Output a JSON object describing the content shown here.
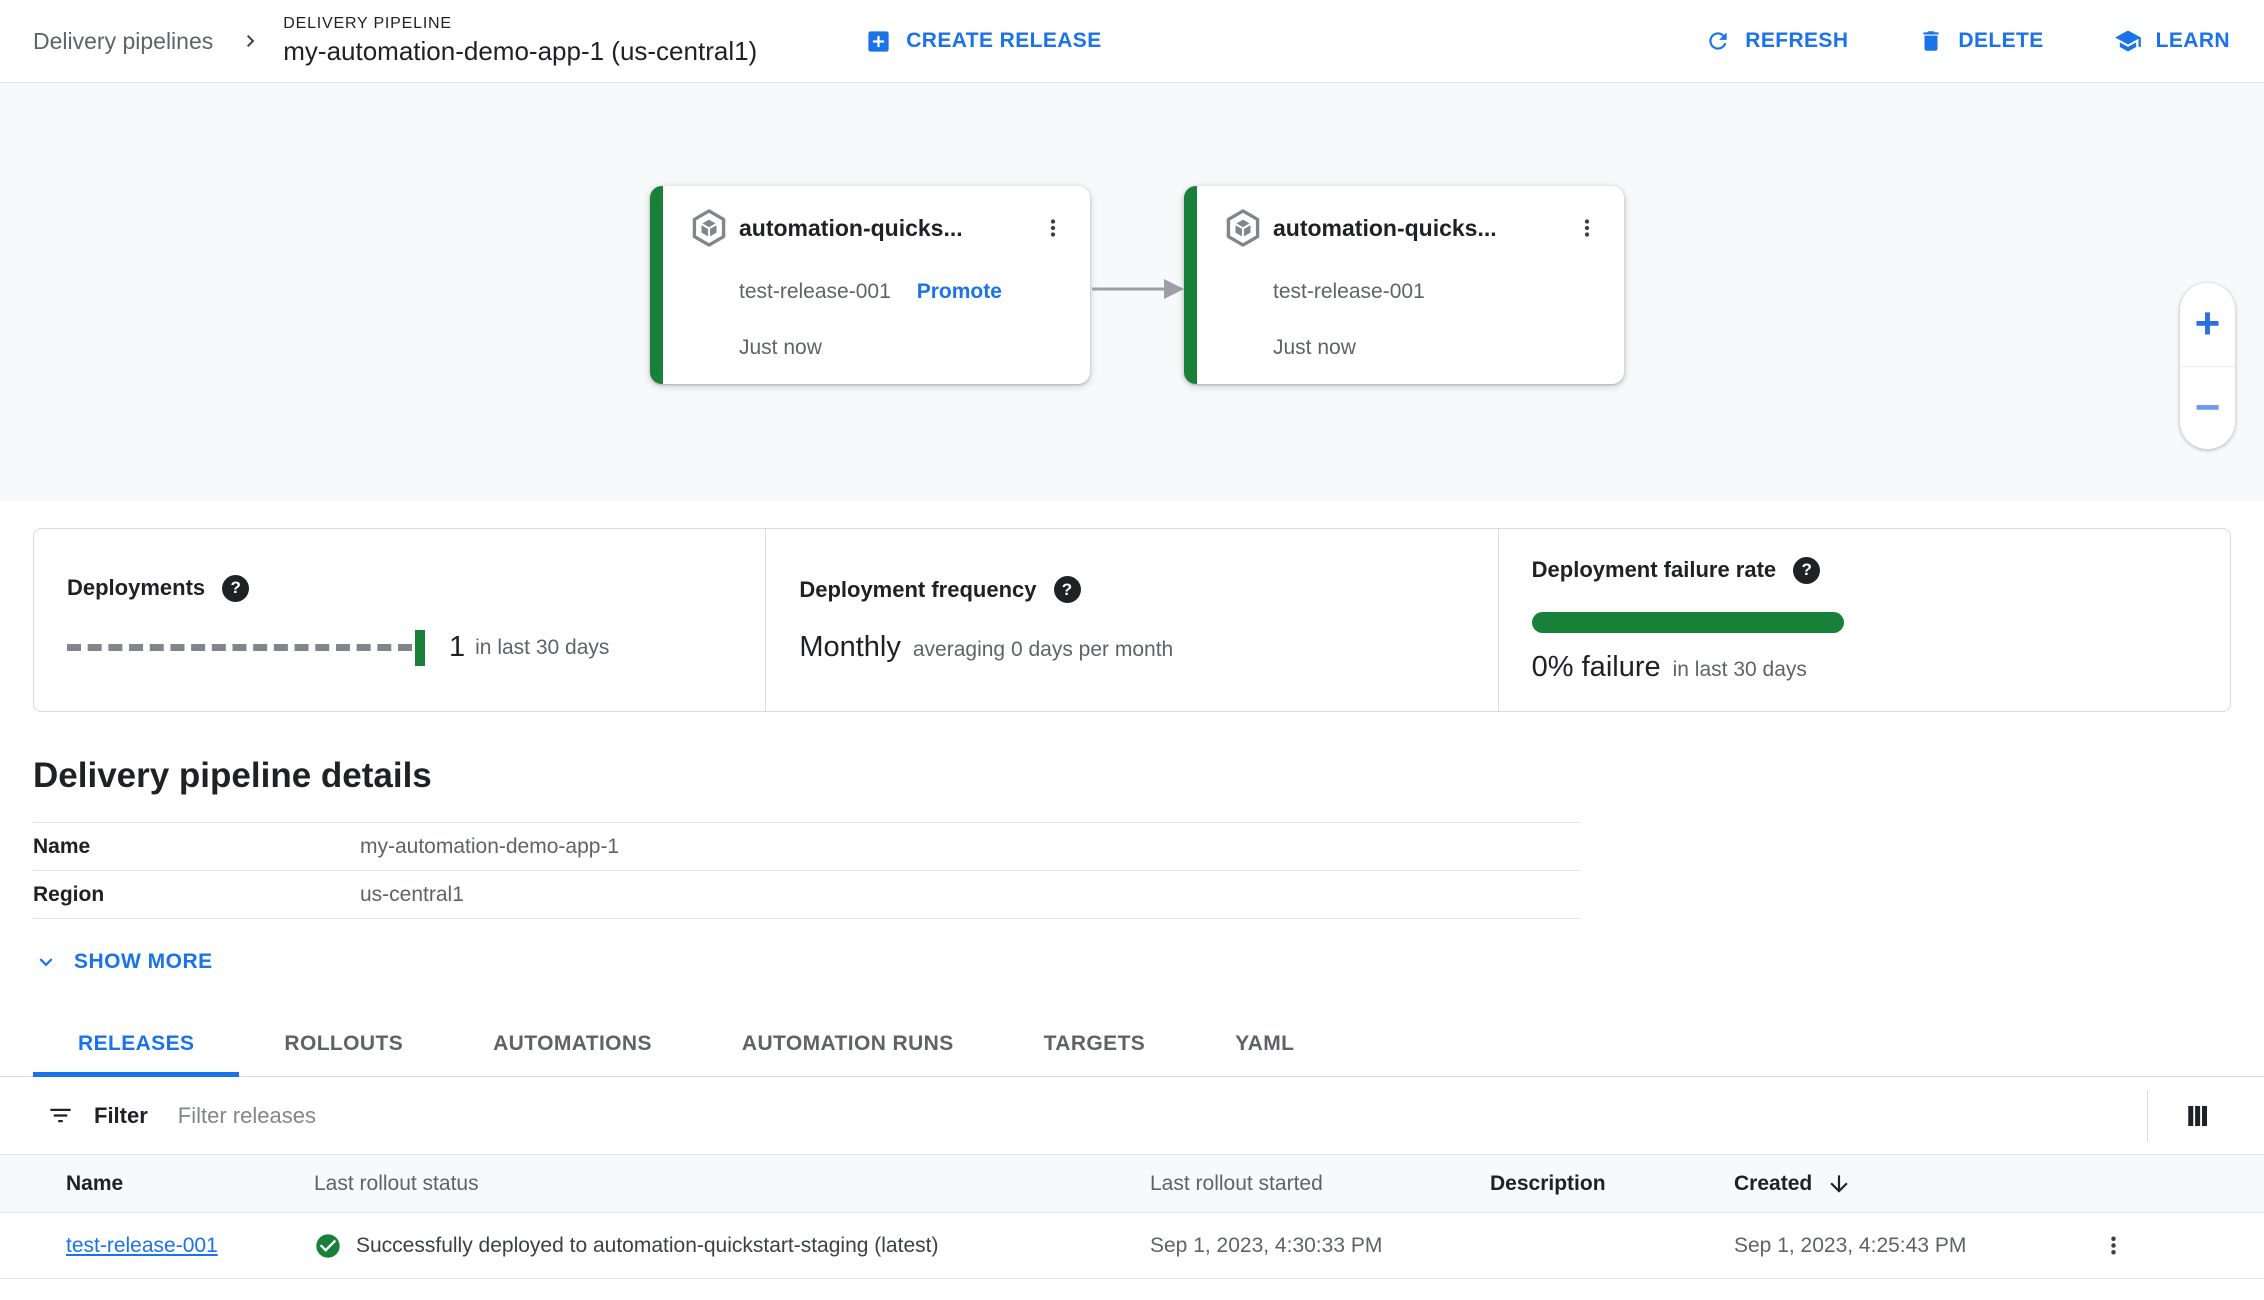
{
  "header": {
    "breadcrumb": "Delivery pipelines",
    "overline": "DELIVERY PIPELINE",
    "title": "my-automation-demo-app-1 (us-central1)",
    "actions": {
      "create_release": "CREATE RELEASE",
      "refresh": "REFRESH",
      "delete": "DELETE",
      "learn": "LEARN"
    }
  },
  "pipeline": {
    "cards": [
      {
        "title": "automation-quicks...",
        "release": "test-release-001",
        "promote_label": "Promote",
        "time": "Just now"
      },
      {
        "title": "automation-quicks...",
        "release": "test-release-001",
        "time": "Just now"
      }
    ],
    "zoom_controls": {
      "zoom_in": "+",
      "zoom_out": "−"
    }
  },
  "metrics": {
    "deployments": {
      "label": "Deployments",
      "value": "1",
      "suffix": "in last 30 days"
    },
    "frequency": {
      "label": "Deployment frequency",
      "value": "Monthly",
      "suffix": "averaging 0 days per month"
    },
    "failure_rate": {
      "label": "Deployment failure rate",
      "value": "0% failure",
      "suffix": "in last 30 days"
    }
  },
  "details": {
    "heading": "Delivery pipeline details",
    "rows": [
      {
        "label": "Name",
        "value": "my-automation-demo-app-1"
      },
      {
        "label": "Region",
        "value": "us-central1"
      }
    ],
    "show_more_label": "SHOW MORE"
  },
  "tabs": {
    "items": [
      "RELEASES",
      "ROLLOUTS",
      "AUTOMATIONS",
      "AUTOMATION RUNS",
      "TARGETS",
      "YAML"
    ],
    "active": "RELEASES"
  },
  "filter": {
    "label": "Filter",
    "placeholder": "Filter releases"
  },
  "releases_table": {
    "columns": {
      "name": "Name",
      "status": "Last rollout status",
      "started": "Last rollout started",
      "description": "Description",
      "created": "Created"
    },
    "rows": [
      {
        "name": "test-release-001",
        "status": "Successfully deployed to automation-quickstart-staging (latest)",
        "started": "Sep 1, 2023, 4:30:33 PM",
        "description": "",
        "created": "Sep 1, 2023, 4:25:43 PM"
      }
    ]
  },
  "icons": {
    "breadcrumb_separator": "chevron-right-icon",
    "create_release": "add-box-icon",
    "refresh": "refresh-icon",
    "delete": "trash-icon",
    "learn": "school-icon",
    "pipeline_card": "target-hexagon-icon",
    "card_menu": "kebab-menu-icon",
    "help": "help-circle-icon",
    "show_more": "chevron-down-icon",
    "filter": "filter-list-icon",
    "columns": "column-bars-icon",
    "sort": "arrow-down-icon",
    "row_status": "check-circle-icon",
    "row_menu": "kebab-menu-icon"
  },
  "colors": {
    "accent": "#1a73e8",
    "success_green": "#188038",
    "text_primary": "#202124",
    "text_secondary": "#5f6368",
    "canvas_bg": "#f8f9fa",
    "divider": "#dadce0"
  }
}
